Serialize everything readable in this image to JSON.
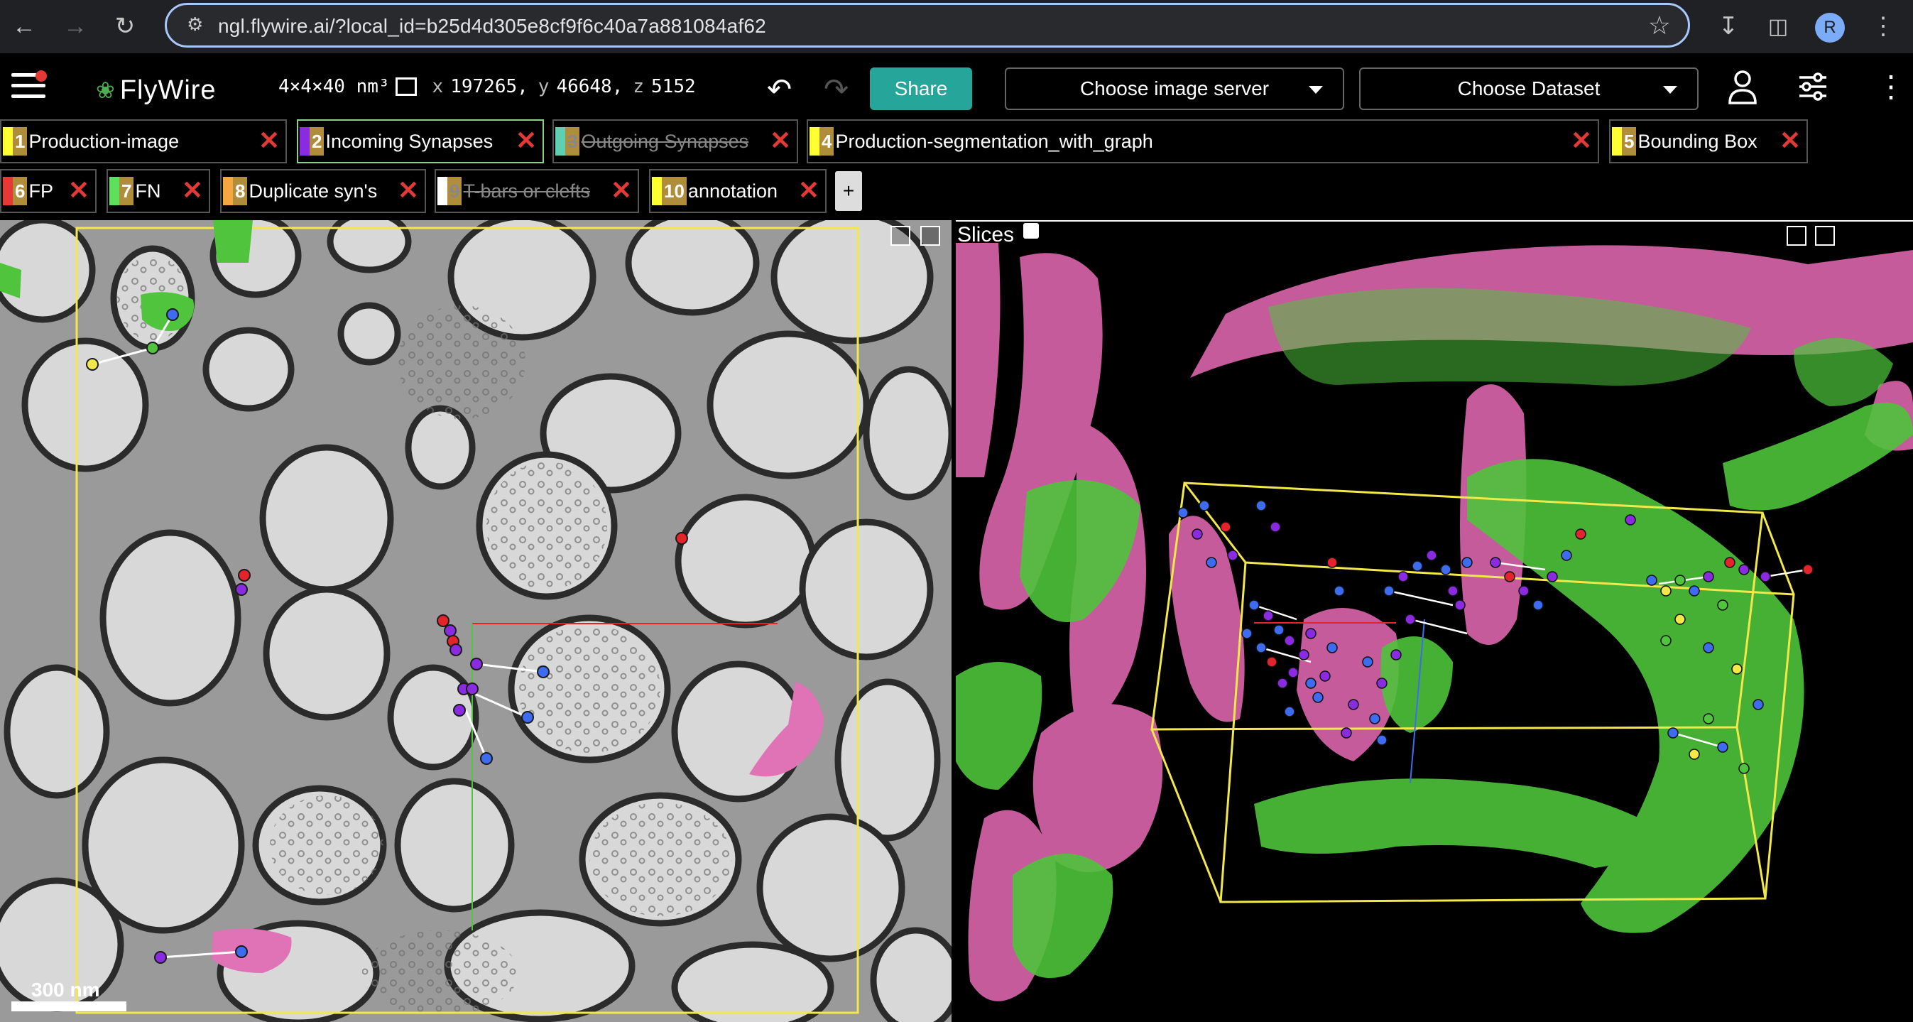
{
  "browser": {
    "url": "ngl.flywire.ai/?local_id=b25d4d305e8cf9f6c40a7a881084af62",
    "profile_initial": "R"
  },
  "app": {
    "logo_text": "FlyWire",
    "resolution": "4×4×40 nm³",
    "coords": {
      "x_label": "x",
      "x": "197265,",
      "y_label": "y",
      "y": "46648,",
      "z_label": "z",
      "z": "5152"
    },
    "share_label": "Share",
    "image_server_label": "Choose image server",
    "dataset_label": "Choose Dataset"
  },
  "layers": [
    {
      "num": "1",
      "name": "Production-image",
      "color": "#ffff33",
      "hidden": false
    },
    {
      "num": "2",
      "name": "Incoming Synapses",
      "color": "#8a2be2",
      "hidden": false,
      "active": true
    },
    {
      "num": "3",
      "name": "Outgoing Synapses",
      "color": "#5ecfb0",
      "hidden": true
    },
    {
      "num": "4",
      "name": "Production-segmentation_with_graph",
      "color": "#ffff33",
      "hidden": false
    },
    {
      "num": "5",
      "name": "Bounding Box",
      "color": "#ffff33",
      "hidden": false
    },
    {
      "num": "6",
      "name": "FP",
      "color": "#e53935",
      "hidden": false
    },
    {
      "num": "7",
      "name": "FN",
      "color": "#5ee05e",
      "hidden": false
    },
    {
      "num": "8",
      "name": "Duplicate syn's",
      "color": "#f5a742",
      "hidden": false
    },
    {
      "num": "9",
      "name": "T-bars or clefts",
      "color": "#ffffff",
      "hidden": true
    },
    {
      "num": "10",
      "name": "annotation",
      "color": "#ffff33",
      "hidden": false
    }
  ],
  "add_layer_label": "+",
  "panels": {
    "scale_bar": "300 nm",
    "slices_label": "Slices"
  },
  "colors": {
    "segment_pink": "#e072b6",
    "segment_green": "#4fc43c",
    "bbox_yellow": "#f2e84a",
    "point_blue": "#3d6cf0",
    "point_purple": "#8a2be2",
    "point_red": "#e5232b"
  }
}
